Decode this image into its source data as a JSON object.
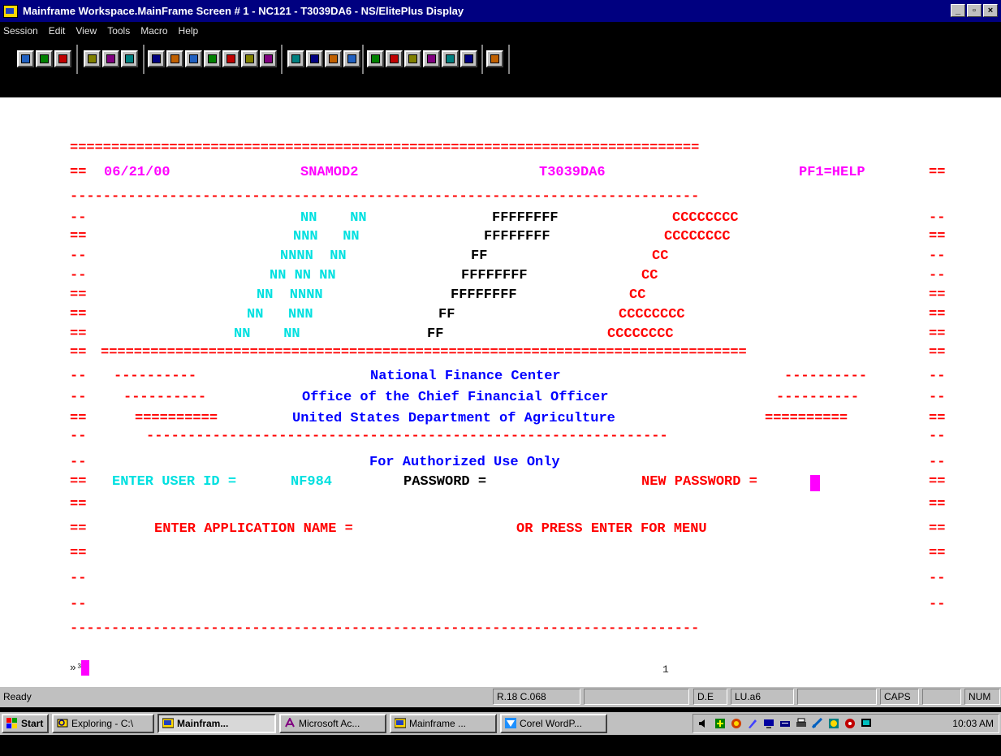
{
  "window": {
    "title": "Mainframe Workspace.MainFrame Screen # 1 - NC121 - T3039DA6 - NS/ElitePlus Display",
    "buttons": [
      "_",
      "▫",
      "×"
    ]
  },
  "menu": [
    "Session",
    "Edit",
    "View",
    "Tools",
    "Macro",
    "Help"
  ],
  "toolbar_icons": [
    "connect-icon",
    "disconnect-icon",
    "properties-icon",
    "cut-icon",
    "copy-icon",
    "paste-icon",
    "font-icon",
    "size-icon",
    "attribute-icon",
    "screen-icon",
    "hotspot-icon",
    "transfer-icon",
    "capture-icon",
    "macro-icon",
    "keyboard-icon",
    "grid-icon",
    "display-icon",
    "send-icon",
    "receive-icon",
    "send-file-icon",
    "receive-file-icon",
    "print-icon",
    "print-screen-icon",
    "help-icon"
  ],
  "terminal": {
    "header": {
      "date": "06/21/00",
      "app_id": "SNAMOD2",
      "terminal_id": "T3039DA6",
      "help_key": "PF1=HELP"
    },
    "logo_n": [
      "NN    NN",
      "NNN   NN",
      "NNNN  NN",
      "NN NN NN",
      "NN  NNNN",
      "NN   NNN",
      "NN    NN"
    ],
    "logo_f": [
      "FFFFFFFF",
      "FFFFFFFF",
      "FF",
      "FFFFFFFF",
      "FFFFFFFF",
      "FF",
      "FF"
    ],
    "logo_c": [
      "CCCCCCCC",
      "CCCCCCCC",
      "CC",
      "CC",
      "CC",
      "CCCCCCCC",
      "CCCCCCCC"
    ],
    "org_line1": "National Finance Center",
    "org_line2": "Office of the Chief Financial Officer",
    "org_line3": "United States Department of Agriculture",
    "notice": "For Authorized Use Only",
    "user_id_label": "ENTER USER ID =",
    "user_id_value": "NF984",
    "password_label": "PASSWORD =",
    "new_password_label": "NEW PASSWORD =",
    "app_name_prompt": "ENTER APPLICATION NAME =",
    "menu_prompt": "OR PRESS ENTER FOR MENU",
    "oia_left": "»³",
    "oia_mid": "1"
  },
  "status": {
    "ready": "Ready",
    "position": "R.18 C.068",
    "blank1": "",
    "de": "D.E",
    "lu": "LU.a6",
    "blank2": "",
    "caps": "CAPS",
    "blank3": "",
    "num": "NUM"
  },
  "taskbar": {
    "start": "Start",
    "tasks": [
      "Exploring - C:\\",
      "Mainfram...",
      "Microsoft Ac...",
      "Mainframe ...",
      "Corel WordP..."
    ],
    "clock": "10:03 AM"
  },
  "colors": {
    "title_bar": "#000080",
    "border_red": "#ff0000",
    "highlight_magenta": "#ff00ff",
    "input_cyan": "#00e0e0",
    "org_blue": "#0000ff"
  }
}
